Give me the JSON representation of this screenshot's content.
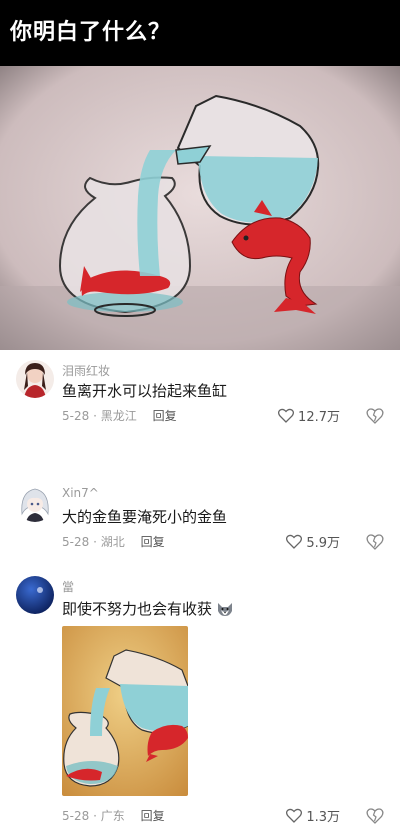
{
  "header": {
    "title": "你明白了什么？"
  },
  "comments": [
    {
      "username": "泪雨红妆",
      "text": "鱼离开水可以抬起来鱼缸",
      "date": "5-28",
      "location": "黑龙江",
      "reply_label": "回复",
      "likes": "12.7万"
    },
    {
      "username": "Xin7^",
      "text": "大的金鱼要淹死小的金鱼",
      "date": "5-28",
      "location": "湖北",
      "reply_label": "回复",
      "likes": "5.9万"
    },
    {
      "username": "當",
      "text": "即使不努力也会有收获",
      "date": "5-28",
      "location": "广东",
      "reply_label": "回复",
      "likes": "1.3万"
    }
  ],
  "icons": {
    "like": "heart-outline-icon",
    "dislike": "broken-heart-icon",
    "emoji": "wolf-face-emoji-icon"
  },
  "colors": {
    "header_bg": "#000000",
    "fish_red": "#d6262b",
    "water": "#8fd0d6",
    "text_secondary": "#9a9a9a"
  }
}
